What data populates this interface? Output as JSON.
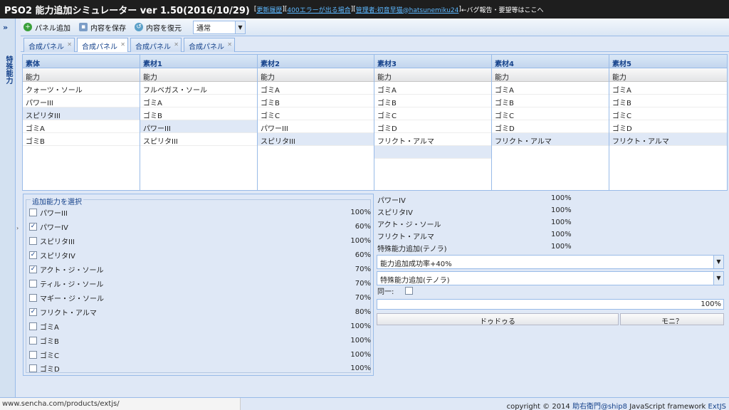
{
  "header": {
    "title": "PSO2 能力追加シミュレーター ver 1.50(2016/10/29)",
    "links": [
      "更新履歴",
      "400エラーが出る場合",
      "管理者:初音早猫@hatsunemiku24"
    ],
    "note": "←バグ報告・要望等はここへ"
  },
  "sidebar": {
    "expand": "»",
    "title": "特殊能力",
    "grip": "›"
  },
  "toolbar": {
    "add_label": "パネル追加",
    "save_label": "内容を保存",
    "restore_label": "内容を復元",
    "mode_value": "通常"
  },
  "tabs": [
    "合成パネル",
    "合成パネル",
    "合成パネル",
    "合成パネル"
  ],
  "grids": {
    "column_header": "能力",
    "columns": [
      {
        "title": "素体",
        "rows": [
          "クォーツ・ソール",
          "パワーIII",
          "スピリタIII",
          "ゴミA",
          "ゴミB"
        ]
      },
      {
        "title": "素材1",
        "rows": [
          "フルベガス・ソール",
          "ゴミA",
          "ゴミB",
          "パワーIII",
          "スピリタIII"
        ]
      },
      {
        "title": "素材2",
        "rows": [
          "ゴミA",
          "ゴミB",
          "ゴミC",
          "パワーIII",
          "スピリタIII"
        ]
      },
      {
        "title": "素材3",
        "rows": [
          "ゴミA",
          "ゴミB",
          "ゴミC",
          "ゴミD",
          "フリクト・アルマ"
        ]
      },
      {
        "title": "素材4",
        "rows": [
          "ゴミA",
          "ゴミB",
          "ゴミC",
          "ゴミD",
          "フリクト・アルマ"
        ]
      },
      {
        "title": "素材5",
        "rows": [
          "ゴミA",
          "ゴミB",
          "ゴミC",
          "ゴミD",
          "フリクト・アルマ"
        ]
      }
    ]
  },
  "abilities": {
    "legend": "追加能力を選択",
    "items": [
      {
        "label": "パワーIII",
        "checked": false,
        "pct": "100%"
      },
      {
        "label": "パワーIV",
        "checked": true,
        "pct": "60%"
      },
      {
        "label": "スピリタIII",
        "checked": false,
        "pct": "100%"
      },
      {
        "label": "スピリタIV",
        "checked": true,
        "pct": "60%"
      },
      {
        "label": "アクト・ジ・ソール",
        "checked": true,
        "pct": "70%"
      },
      {
        "label": "ティル・ジ・ソール",
        "checked": false,
        "pct": "70%"
      },
      {
        "label": "マギー・ジ・ソール",
        "checked": false,
        "pct": "70%"
      },
      {
        "label": "フリクト・アルマ",
        "checked": true,
        "pct": "80%"
      },
      {
        "label": "ゴミA",
        "checked": false,
        "pct": "100%"
      },
      {
        "label": "ゴミB",
        "checked": false,
        "pct": "100%"
      },
      {
        "label": "ゴミC",
        "checked": false,
        "pct": "100%"
      },
      {
        "label": "ゴミD",
        "checked": false,
        "pct": "100%"
      }
    ]
  },
  "results": {
    "items": [
      {
        "name": "パワーIV",
        "pct": "100%"
      },
      {
        "name": "スピリタIV",
        "pct": "100%"
      },
      {
        "name": "アクト・ジ・ソール",
        "pct": "100%"
      },
      {
        "name": "フリクト・アルマ",
        "pct": "100%"
      },
      {
        "name": "特殊能力追加(テノラ)",
        "pct": "100%"
      }
    ],
    "boost_select": "能力追加成功率+40%",
    "special_select": "特殊能力追加(テノラ)",
    "same_label": "同一:",
    "progress": 1.0,
    "progress_text": "100%",
    "button1": "ドゥドゥる",
    "button2": "モニ？"
  },
  "status": {
    "url": "www.sencha.com/products/extjs/",
    "copyright_prefix": "copyright © 2014 ",
    "author": "助右衛門@ship8",
    "copyright_suffix": " JavaScript framework ",
    "framework": "ExtJS"
  }
}
